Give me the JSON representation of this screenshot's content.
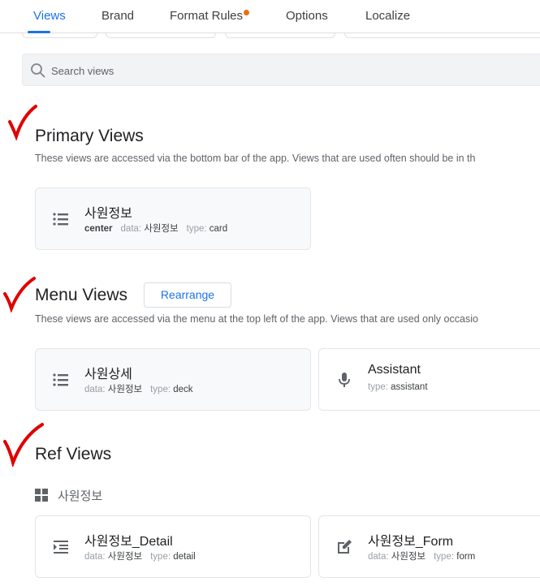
{
  "tabs": [
    {
      "label": "Views",
      "active": true
    },
    {
      "label": "Brand"
    },
    {
      "label": "Format Rules",
      "has_dot": true
    },
    {
      "label": "Options"
    },
    {
      "label": "Localize"
    }
  ],
  "search": {
    "placeholder": "Search views"
  },
  "primary": {
    "title": "Primary Views",
    "description": "These views are accessed via the bottom bar of the app. Views that are used often should be in th",
    "items": [
      {
        "name": "사원정보",
        "position": "center",
        "data_label": "data:",
        "data": "사원정보",
        "type_label": "type:",
        "type": "card",
        "icon": "list-icon"
      }
    ]
  },
  "menu": {
    "title": "Menu Views",
    "rearrange": "Rearrange",
    "description": "These views are accessed via the menu at the top left of the app. Views that are used only occasio",
    "items": [
      {
        "name": "사원상세",
        "data_label": "data:",
        "data": "사원정보",
        "type_label": "type:",
        "type": "deck",
        "icon": "list-icon"
      },
      {
        "name": "Assistant",
        "type_label": "type:",
        "type": "assistant",
        "icon": "microphone-icon"
      }
    ]
  },
  "ref": {
    "title": "Ref Views",
    "group": "사원정보",
    "items": [
      {
        "name": "사원정보_Detail",
        "data_label": "data:",
        "data": "사원정보",
        "type_label": "type:",
        "type": "detail",
        "icon": "detail-icon"
      },
      {
        "name": "사원정보_Form",
        "data_label": "data:",
        "data": "사원정보",
        "type_label": "type:",
        "type": "form",
        "icon": "edit-icon"
      }
    ]
  },
  "colors": {
    "accent": "#1a73e8",
    "dot": "#e8710a",
    "check": "#e00000"
  }
}
